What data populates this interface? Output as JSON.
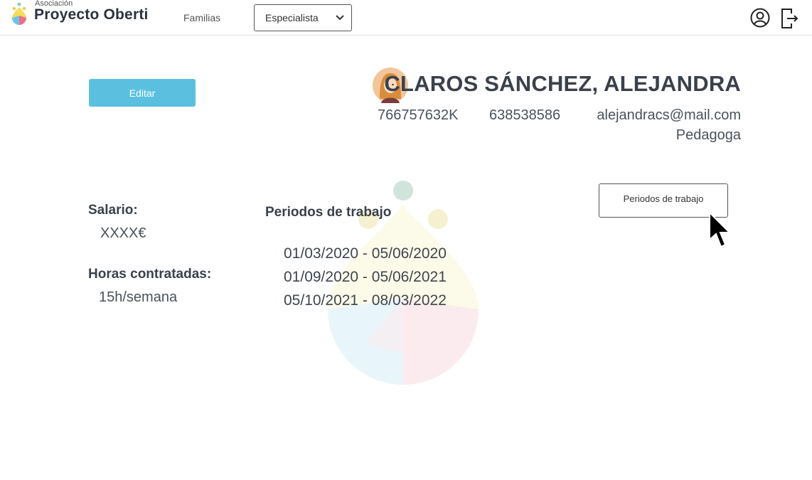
{
  "header": {
    "logo_small": "Asociación",
    "logo_main": "Proyecto Oberti",
    "nav_familias": "Familias",
    "role_select": {
      "value": "Especialista"
    }
  },
  "profile": {
    "edit_label": "Editar",
    "name": "CLAROS SÁNCHEZ, ALEJANDRA",
    "dni": "766757632K",
    "phone": "638538586",
    "email": "alejandracs@mail.com",
    "role": "Pedagoga"
  },
  "details": {
    "salary_label": "Salario:",
    "salary_value": "XXXX€",
    "hours_label": "Horas contratadas:",
    "hours_value": "15h/semana",
    "periods_title": "Periodos de trabajo",
    "periods": [
      "01/03/2020 - 05/06/2020",
      "01/09/2020 - 05/06/2021",
      "05/10/2021 - 08/03/2022"
    ],
    "periods_button": "Periodos de trabajo"
  },
  "colors": {
    "accent": "#5bc0e0",
    "text": "#3a414b"
  }
}
